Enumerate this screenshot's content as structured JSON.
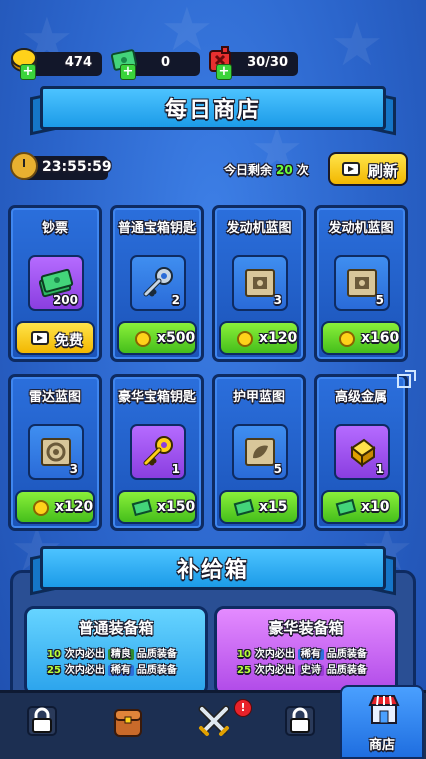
{
  "currencies": [
    {
      "icon": "gold-coin-icon",
      "value": "474"
    },
    {
      "icon": "cash-icon",
      "value": "0"
    },
    {
      "icon": "energy-fuel-icon",
      "value": "30/30"
    }
  ],
  "daily_shop": {
    "title": "每日商店",
    "timer": "23:55:59",
    "remaining_prefix": "今日剩余",
    "remaining_count": "20",
    "remaining_suffix": "次",
    "refresh_label": "刷新"
  },
  "items": [
    {
      "name": "钞票",
      "icon": "cash-stack-icon",
      "count": "200",
      "price_type": "video",
      "price": "免费"
    },
    {
      "name": "普通宝箱钥匙",
      "icon": "silver-key-icon",
      "count": "2",
      "price_type": "gold",
      "price": "x500"
    },
    {
      "name": "发动机蓝图",
      "icon": "engine-blueprint-icon",
      "count": "3",
      "price_type": "gold",
      "price": "x120"
    },
    {
      "name": "发动机蓝图",
      "icon": "engine-blueprint-icon",
      "count": "5",
      "price_type": "gold",
      "price": "x160"
    },
    {
      "name": "雷达蓝图",
      "icon": "radar-blueprint-icon",
      "count": "3",
      "price_type": "gold",
      "price": "x120"
    },
    {
      "name": "豪华宝箱钥匙",
      "icon": "gold-key-icon",
      "count": "1",
      "price_type": "cash",
      "price": "x150"
    },
    {
      "name": "护甲蓝图",
      "icon": "armor-blueprint-icon",
      "count": "5",
      "price_type": "cash",
      "price": "x15"
    },
    {
      "name": "高级金属",
      "icon": "gold-metal-icon",
      "count": "1",
      "price_type": "cash",
      "price": "x10"
    }
  ],
  "supply": {
    "title": "补给箱",
    "chests": [
      {
        "title": "普通装备箱",
        "rows": [
          {
            "n": "10",
            "text": "次内必出",
            "quality": "精良",
            "suffix": "品质装备"
          },
          {
            "n": "25",
            "text": "次内必出",
            "quality": "稀有",
            "suffix": "品质装备"
          }
        ]
      },
      {
        "title": "豪华装备箱",
        "rows": [
          {
            "n": "10",
            "text": "次内必出",
            "quality": "稀有",
            "suffix": "品质装备"
          },
          {
            "n": "25",
            "text": "次内必出",
            "quality": "史诗",
            "suffix": "品质装备"
          }
        ]
      }
    ]
  },
  "nav": {
    "tabs": [
      {
        "icon": "locked-icon"
      },
      {
        "icon": "backpack-icon"
      },
      {
        "icon": "crossed-swords-icon",
        "badge": "!"
      },
      {
        "icon": "locked-icon"
      },
      {
        "icon": "shop-icon",
        "label": "商店",
        "active": true
      }
    ]
  },
  "colors": {
    "accent_yellow": "#f2b700",
    "accent_green": "#45be1c",
    "background_blue": "#2a63c9",
    "quality_green": "#2f8a2f",
    "quality_blue": "#2b6fdc",
    "quality_purple": "#9b3bd6"
  }
}
